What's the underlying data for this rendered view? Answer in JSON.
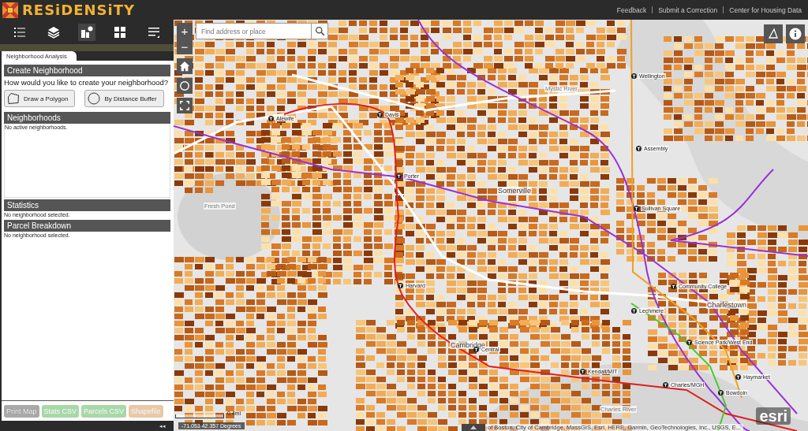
{
  "header": {
    "logo_text": "RESiDENSiTY",
    "links": [
      "Feedback",
      "Submit a Correction",
      "Center for Housing Data"
    ]
  },
  "toolbar": [
    {
      "kind": "legend",
      "selected": false
    },
    {
      "kind": "layers",
      "selected": false
    },
    {
      "kind": "analysis",
      "selected": true
    },
    {
      "kind": "grid",
      "selected": false
    },
    {
      "kind": "list",
      "selected": false
    }
  ],
  "panel": {
    "tab": "Neighborhood Analysis",
    "create": {
      "title": "Create Neighborhood",
      "question": "How would you like to create your neighborhood?",
      "buttons": [
        {
          "kind": "polygon",
          "label": "Draw a Polygon"
        },
        {
          "kind": "buffer",
          "label": "By Distance Buffer"
        }
      ]
    },
    "sections": [
      {
        "kind": "box",
        "title": "Neighborhoods",
        "message": "No active neighborhoods."
      },
      {
        "kind": "plain",
        "title": "Statistics",
        "message": "No neighborhood selected."
      },
      {
        "kind": "plain",
        "title": "Parcel Breakdown",
        "message": "No neighborhood selected."
      }
    ],
    "export_buttons": [
      {
        "label": "Print Map",
        "disabled": false,
        "color": "#a9a9a9"
      },
      {
        "label": "Stats CSV",
        "disabled": true,
        "color": "#a8d8a8"
      },
      {
        "label": "Parcels CSV",
        "disabled": true,
        "color": "#a8d8a8"
      },
      {
        "label": "Shapefile",
        "disabled": true,
        "color": "#e8c8a8"
      }
    ],
    "collapse": "◂◂"
  },
  "map": {
    "search": {
      "placeholder": "Find address or place"
    },
    "zoom_in": "+",
    "zoom_out": "−",
    "labels": [
      {
        "kind": "station",
        "text": "Alewife"
      },
      {
        "kind": "station",
        "text": "Davis"
      },
      {
        "kind": "station",
        "text": "Porter"
      },
      {
        "kind": "place",
        "text": "Somerville"
      },
      {
        "kind": "water",
        "text": "Fresh Pond"
      },
      {
        "kind": "water",
        "text": "Mystic River"
      },
      {
        "kind": "station",
        "text": "Wellington"
      },
      {
        "kind": "station",
        "text": "Assembly"
      },
      {
        "kind": "station",
        "text": "Sullivan Square"
      },
      {
        "kind": "station",
        "text": "Harvard"
      },
      {
        "kind": "station",
        "text": "Community College"
      },
      {
        "kind": "place",
        "text": "Charlestown"
      },
      {
        "kind": "station",
        "text": "Lechmere"
      },
      {
        "kind": "station",
        "text": "Science Park/West End"
      },
      {
        "kind": "place",
        "text": "Cambridge"
      },
      {
        "kind": "station",
        "text": "Central"
      },
      {
        "kind": "station",
        "text": "Kendall/MIT"
      },
      {
        "kind": "station",
        "text": "Charles/MGH"
      },
      {
        "kind": "station",
        "text": "Bowdoin"
      },
      {
        "kind": "station",
        "text": "Haymarket"
      },
      {
        "kind": "water",
        "text": "Charles River"
      }
    ],
    "scale": "0.4mi",
    "coordinates": "-71.053 42.357 Degrees",
    "attribution": "of Boston, City of Cambridge, MassGIS, Esri, HERE, Garmin, GeoTechnologies, Inc., USGS, E...",
    "esri": "esri"
  }
}
